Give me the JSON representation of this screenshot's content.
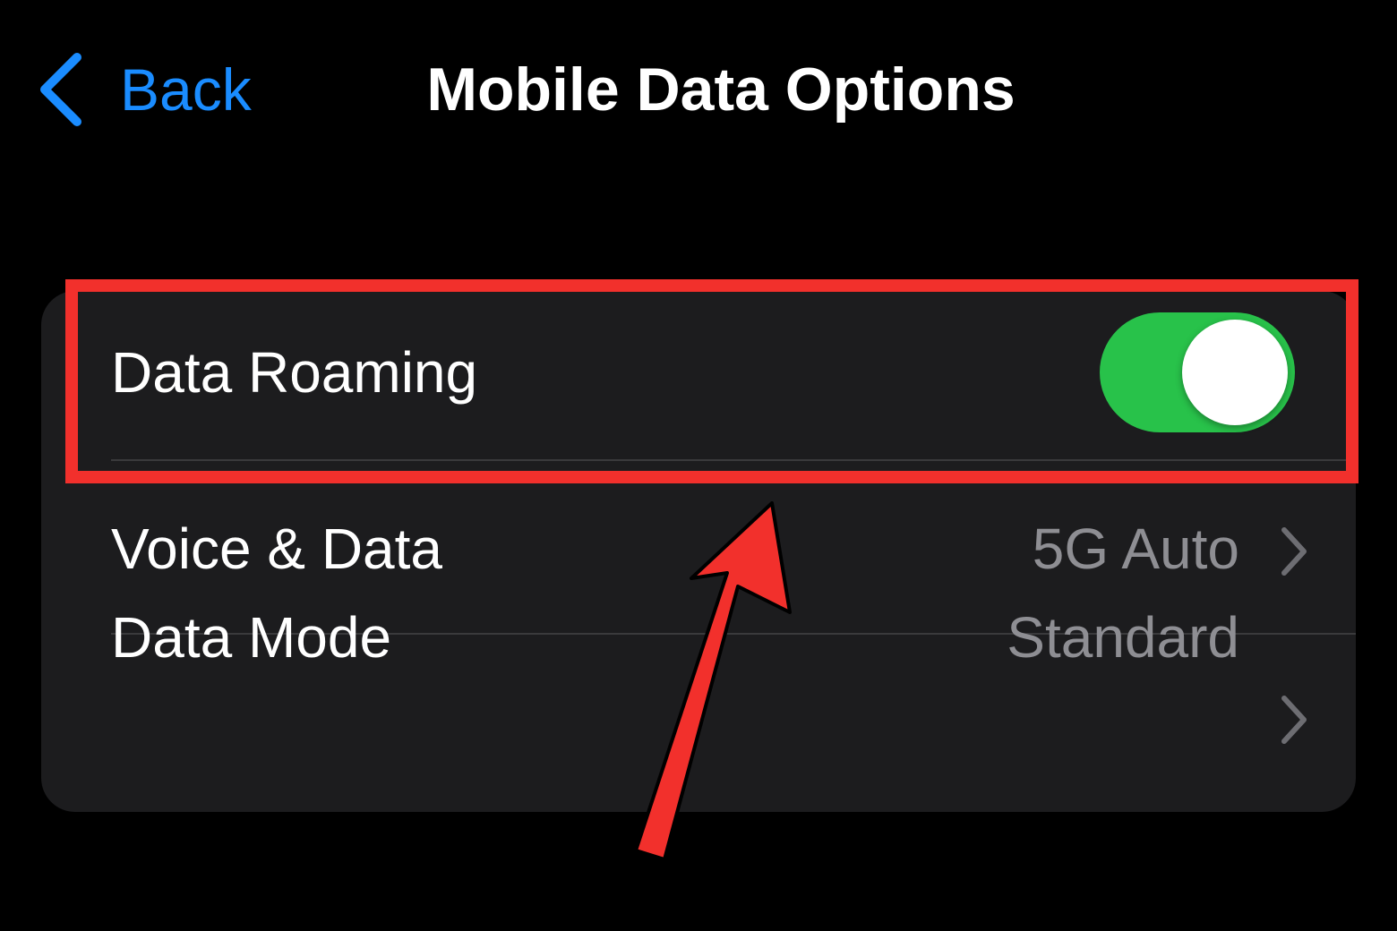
{
  "nav": {
    "back_label": "Back",
    "title": "Mobile Data Options",
    "back_icon": "chevron-left-icon"
  },
  "settings": {
    "rows": [
      {
        "label": "Data Roaming",
        "type": "toggle",
        "toggle_on": true
      },
      {
        "label": "Voice & Data",
        "value": "5G Auto",
        "icon": "chevron-right-icon"
      },
      {
        "label": "Data Mode",
        "value": "Standard",
        "icon": "chevron-right-icon"
      }
    ]
  },
  "annotation": {
    "highlight_target": "Data Roaming",
    "color": "#f2302c"
  },
  "colors": {
    "background": "#000000",
    "group_background": "#1c1c1e",
    "accent_blue": "#1a8cff",
    "toggle_on": "#28c24a",
    "secondary_text": "#8e8e93",
    "annotation_red": "#f2302c"
  }
}
